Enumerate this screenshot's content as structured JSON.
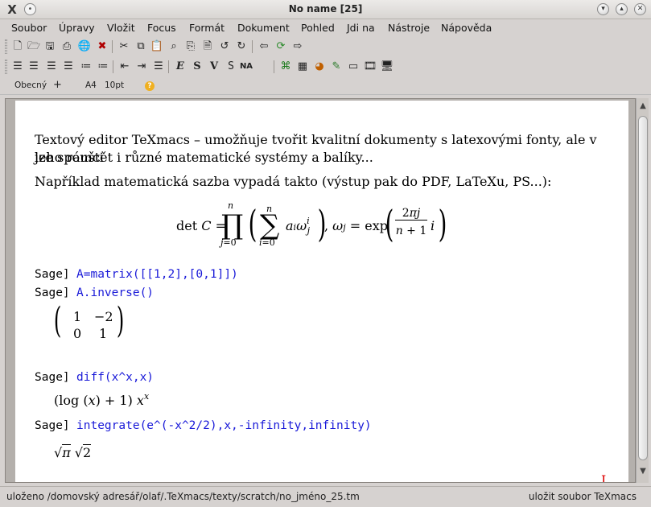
{
  "window": {
    "title": "No name [25]",
    "app_icon": "texmacs-x-icon",
    "buttons": [
      "minimize",
      "maximize",
      "close"
    ]
  },
  "menu": [
    "Soubor",
    "Úpravy",
    "Vložit",
    "Focus",
    "Formát",
    "Dokument",
    "Pohled",
    "Jdi na",
    "Nástroje",
    "Nápověda"
  ],
  "focusbar": {
    "style": "Obecný",
    "add": "+",
    "paper": "A4",
    "font_size": "10pt",
    "help": "?"
  },
  "document": {
    "para1_line1": "Textový editor TeXmacs – umožňuje tvořit kvalitní dokumenty s latexovými fonty, ale v jeho rámci",
    "para1_line2": "lze spouštět i různé matematické systémy a balíky...",
    "para2": "Například matematická sazba vypadá takto (výstup pak do PDF, LaTeXu, PS...):",
    "sessions": [
      {
        "prompt": "Sage]",
        "input": "A=matrix([[1,2],[0,1]])"
      },
      {
        "prompt": "Sage]",
        "input": "A.inverse()"
      },
      {
        "prompt": "Sage]",
        "input": "diff(x^x,x)"
      },
      {
        "prompt": "Sage]",
        "input": "integrate(e^(-x^2/2),x,-infinity,infinity)"
      }
    ],
    "matrix": [
      [
        "1",
        "−2"
      ],
      [
        "0",
        "1"
      ]
    ]
  },
  "status": {
    "left": "uloženo /domovský adresář/olaf/.TeXmacs/texty/scratch/no_jméno_25.tm",
    "right": "uložit soubor TeXmacs"
  },
  "colors": {
    "sage_input": "#1a1ad8",
    "cursor": "#dd0000"
  }
}
